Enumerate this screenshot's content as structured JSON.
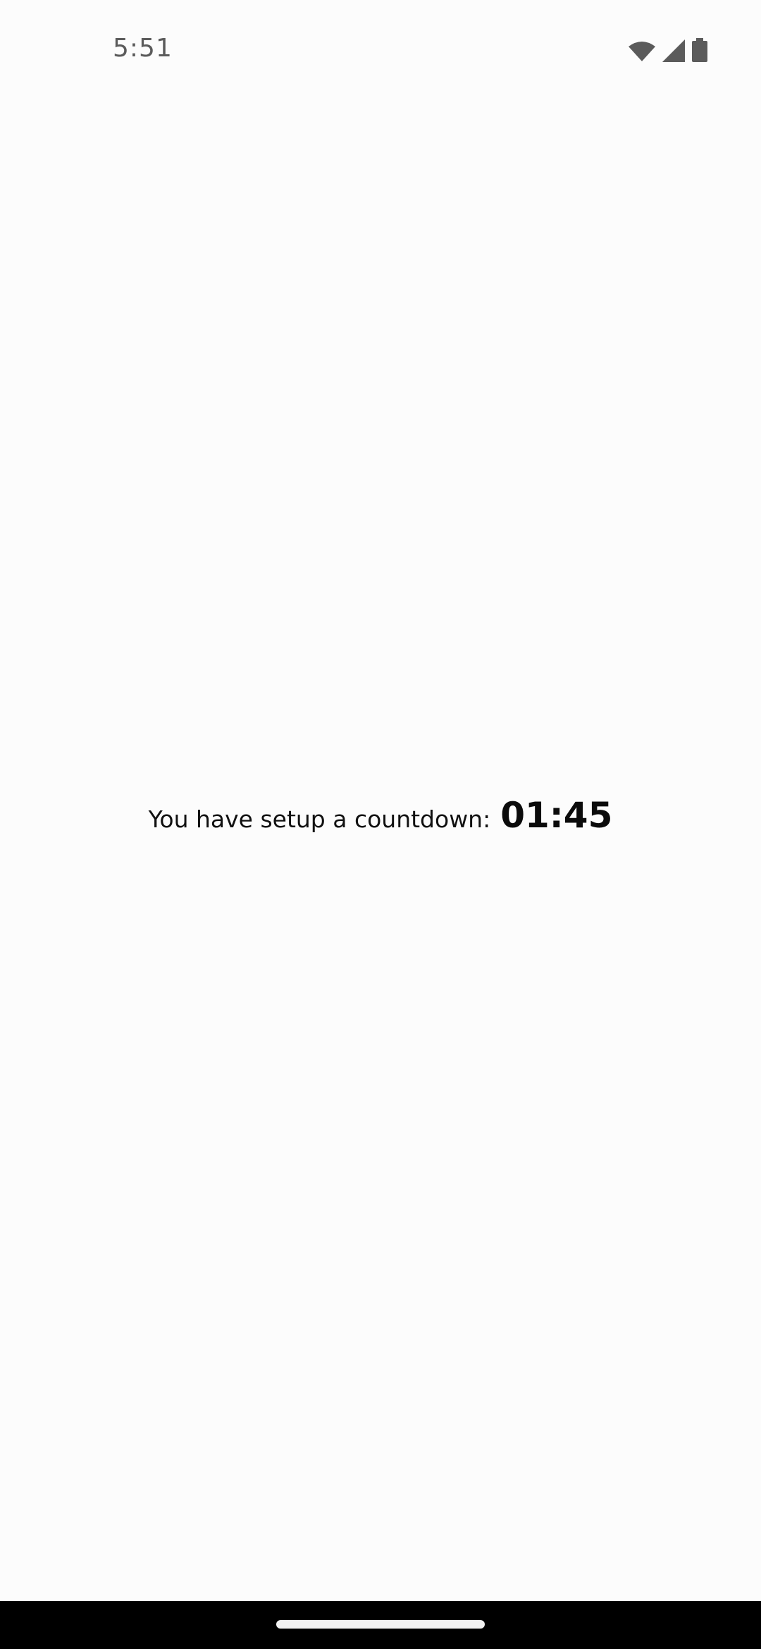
{
  "status_bar": {
    "time": "5:51",
    "icons": [
      "wifi-icon",
      "cellular-signal-icon",
      "battery-icon"
    ]
  },
  "countdown": {
    "label": "You have setup a countdown:",
    "value": "01:45"
  },
  "colors": {
    "background": "#fcfcfc",
    "text": "#111111",
    "nav_bar": "#000000"
  }
}
